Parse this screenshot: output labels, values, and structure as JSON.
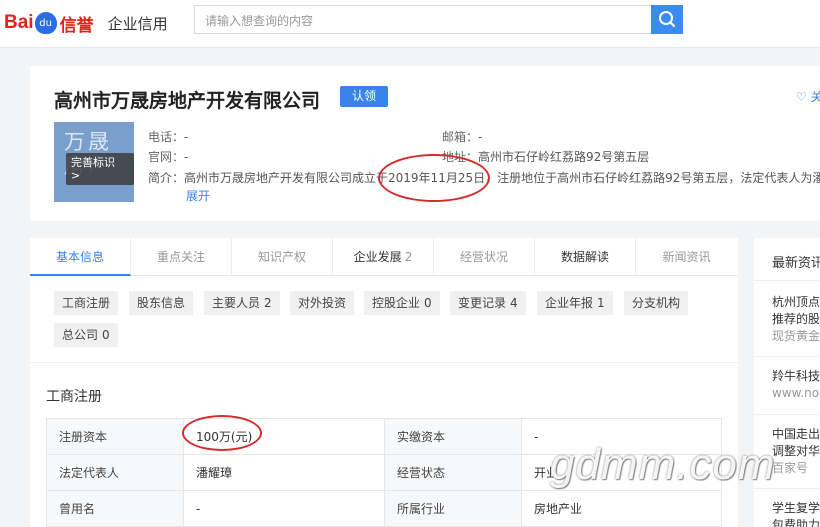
{
  "header": {
    "logo_bai": "Bai",
    "logo_du": "du",
    "logo_xinyu": "信誉",
    "logo_sub": "企业信用",
    "search_placeholder": "请输入想查询的内容",
    "search_icon": "search-icon"
  },
  "company": {
    "name": "高州市万晟房地产开发有限公司",
    "claim_label": "认领",
    "follow_label": "♡ 关",
    "logo_text": "万晟房产",
    "badge_text": "完善标识",
    "badge_arrow": ">",
    "phone_label": "电话：",
    "phone_value": "-",
    "email_label": "邮箱：",
    "email_value": "-",
    "website_label": "官网：",
    "website_value": "-",
    "address_label": "地址：",
    "address_value": "高州市石仔岭红荔路92号第五层",
    "intro_label": "简介：",
    "intro_text": "高州市万晟房地产开发有限公司成立于2019年11月25日，注册地位于高州市石仔岭红荔路92号第五层，法定代表人为潘",
    "expand_label": "展开"
  },
  "tabs": [
    {
      "label": "基本信息",
      "count": ""
    },
    {
      "label": "重点关注",
      "count": ""
    },
    {
      "label": "知识产权",
      "count": ""
    },
    {
      "label": "企业发展",
      "count": "2"
    },
    {
      "label": "经营状况",
      "count": ""
    },
    {
      "label": "数据解读",
      "count": ""
    },
    {
      "label": "新闻资讯",
      "count": ""
    }
  ],
  "chips": [
    {
      "label": "工商注册",
      "count": ""
    },
    {
      "label": "股东信息",
      "count": ""
    },
    {
      "label": "主要人员",
      "count": "2"
    },
    {
      "label": "对外投资",
      "count": ""
    },
    {
      "label": "控股企业",
      "count": "0"
    },
    {
      "label": "变更记录",
      "count": "4"
    },
    {
      "label": "企业年报",
      "count": "1"
    },
    {
      "label": "分支机构",
      "count": ""
    },
    {
      "label": "总公司",
      "count": "0"
    }
  ],
  "section_title": "工商注册",
  "table": [
    {
      "k1": "注册资本",
      "v1": "100万(元)",
      "k2": "实缴资本",
      "v2": "-"
    },
    {
      "k1": "法定代表人",
      "v1": "潘耀璋",
      "k2": "经营状态",
      "v2": "开业"
    },
    {
      "k1": "曾用名",
      "v1": "-",
      "k2": "所属行业",
      "v2": "房地产业"
    }
  ],
  "right": {
    "title": "最新资讯",
    "items": [
      {
        "l1": "杭州顶点",
        "l2": "推荐的股",
        "src": "现货黄金"
      },
      {
        "l1": "羚牛科技",
        "l2": "",
        "src": "www.no"
      },
      {
        "l1": "中国走出",
        "l2": "调整对华",
        "src": "百家号"
      },
      {
        "l1": "学生复学",
        "l2": "包费助力",
        "src": ""
      }
    ]
  },
  "watermark": "gdmm.com",
  "colors": {
    "accent": "#3a83ea",
    "annotation": "#d32c2c",
    "brand_red": "#e2231a"
  }
}
